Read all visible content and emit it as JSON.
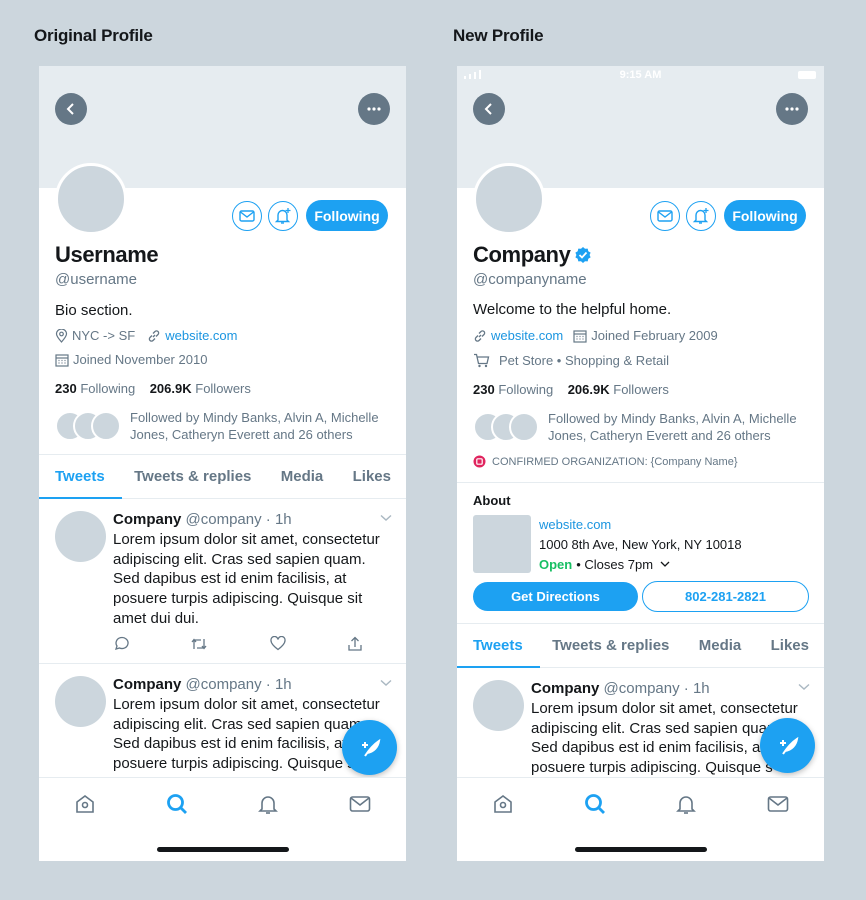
{
  "titles": {
    "original": "Original Profile",
    "new": "New Profile"
  },
  "colors": {
    "accent": "#1da1f2",
    "text": "#14171a",
    "muted": "#657786",
    "open": "#17bf63",
    "background": "#ccd6dd"
  },
  "original": {
    "name": "Username",
    "handle": "@username",
    "bio": "Bio section.",
    "location": "NYC -> SF",
    "website": "website.com",
    "joined": "Joined November 2010",
    "following_count": "230",
    "following_label": "Following",
    "followers_count": "206.9K",
    "followers_label": "Followers",
    "followed_by": "Followed by Mindy Banks, Alvin A, Michelle Jones, Catheryn Everett and 26 others",
    "follow_button": "Following",
    "tabs": [
      "Tweets",
      "Tweets & replies",
      "Media",
      "Likes"
    ],
    "tweets": [
      {
        "name": "Company",
        "handle": "@company",
        "time": "· 1h",
        "text": "Lorem ipsum dolor sit amet, consectetur adipiscing elit. Cras sed sapien quam. Sed dapibus est id enim facilisis, at posuere turpis adipiscing. Quisque sit amet dui dui."
      },
      {
        "name": "Company",
        "handle": "@company",
        "time": "· 1h",
        "text": "Lorem ipsum dolor sit amet, consectetur adipiscing elit. Cras sed sapien quam. Sed dapibus est id enim facilisis, at posuere turpis adipiscing. Quisque sit"
      }
    ]
  },
  "new": {
    "status_time": "9:15 AM",
    "name": "Company",
    "handle": "@companyname",
    "bio": "Welcome to the helpful home.",
    "website": "website.com",
    "joined": "Joined February 2009",
    "category": "Pet Store • Shopping & Retail",
    "following_count": "230",
    "following_label": "Following",
    "followers_count": "206.9K",
    "followers_label": "Followers",
    "followed_by": "Followed by Mindy Banks, Alvin A, Michelle Jones, Catheryn Everett and 26 others",
    "confirmed": "CONFIRMED ORGANIZATION: {Company Name}",
    "follow_button": "Following",
    "about": {
      "title": "About",
      "website": "website.com",
      "address": "1000 8th Ave, New York, NY 10018",
      "open": "Open",
      "hours": "• Closes 7pm",
      "directions": "Get Directions",
      "phone": "802-281-2821"
    },
    "tabs": [
      "Tweets",
      "Tweets & replies",
      "Media",
      "Likes"
    ],
    "tweet": {
      "name": "Company",
      "handle": "@company",
      "time": "· 1h",
      "text": "Lorem ipsum dolor sit amet, consectetur adipiscing elit. Cras sed sapien quam. Sed dapibus est id enim facilisis, at posuere turpis adipiscing. Quisque s"
    }
  }
}
